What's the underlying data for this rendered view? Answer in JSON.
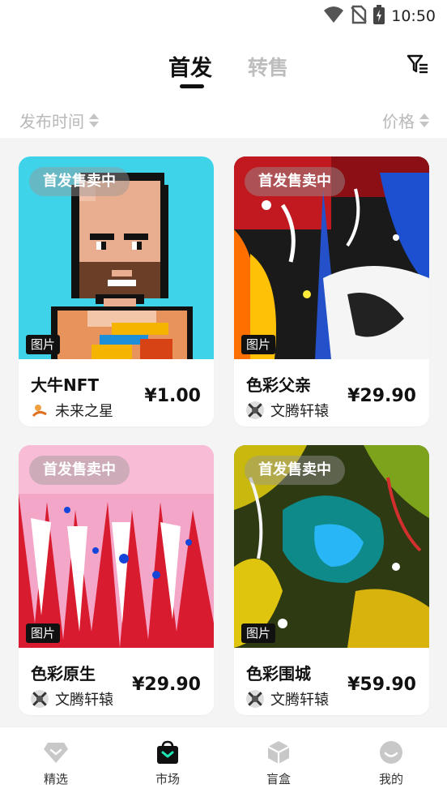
{
  "status": {
    "time": "10:50"
  },
  "header": {
    "tabs": [
      {
        "label": "首发",
        "active": true
      },
      {
        "label": "转售",
        "active": false
      }
    ]
  },
  "sort": {
    "time_label": "发布时间",
    "price_label": "价格"
  },
  "cards": [
    {
      "sale_badge": "首发售卖中",
      "type_badge": "图片",
      "title": "大牛NFT",
      "creator": "未来之星",
      "price": "¥1.00"
    },
    {
      "sale_badge": "首发售卖中",
      "type_badge": "图片",
      "title": "色彩父亲",
      "creator": "文腾轩辕",
      "price": "¥29.90"
    },
    {
      "sale_badge": "首发售卖中",
      "type_badge": "图片",
      "title": "色彩原生",
      "creator": "文腾轩辕",
      "price": "¥29.90"
    },
    {
      "sale_badge": "首发售卖中",
      "type_badge": "图片",
      "title": "色彩围城",
      "creator": "文腾轩辕",
      "price": "¥59.90"
    }
  ],
  "nav": {
    "items": [
      {
        "label": "精选",
        "icon": "diamond-icon"
      },
      {
        "label": "市场",
        "icon": "market-bag-icon",
        "active": true
      },
      {
        "label": "盲盒",
        "icon": "cube-icon"
      },
      {
        "label": "我的",
        "icon": "face-icon"
      }
    ]
  },
  "colors": {
    "active_nav": "#1de9b6",
    "badge_bg": "#111111",
    "muted": "#bdbdbd"
  }
}
